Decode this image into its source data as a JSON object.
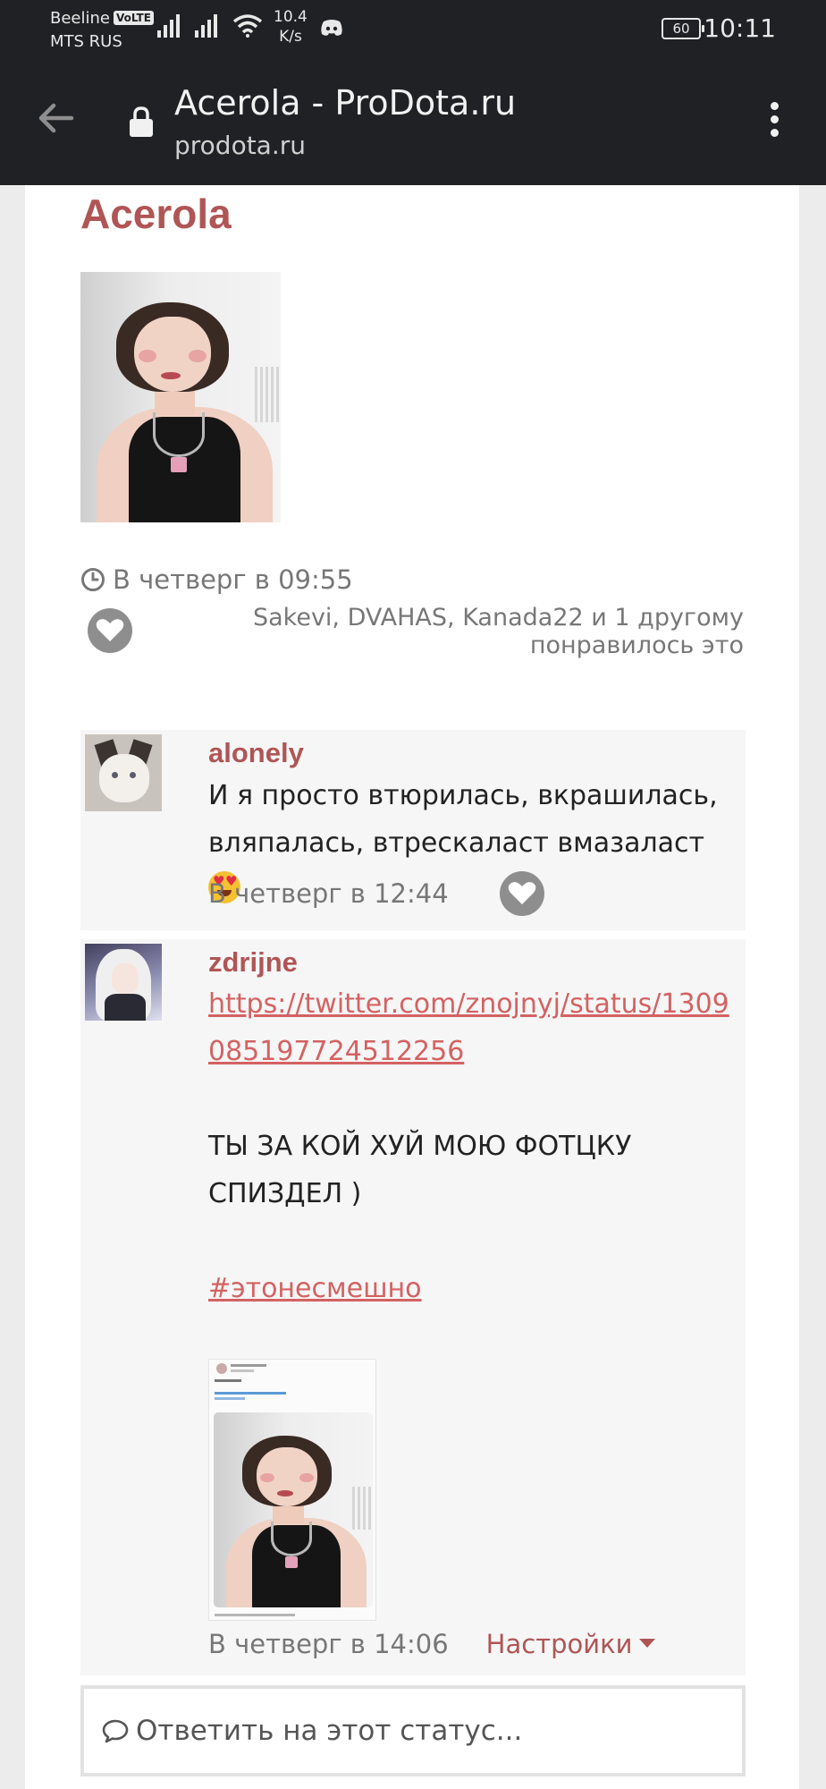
{
  "statusbar": {
    "carrier_1": "Beeline",
    "volte": "VoLTE",
    "carrier_2": "MTS RUS",
    "net_speed_value": "10.4",
    "net_speed_unit": "K/s",
    "battery": "60",
    "time": "10:11"
  },
  "browser": {
    "page_title": "Acerola - ProDota.ru",
    "url": "prodota.ru"
  },
  "profile": {
    "name": "Acerola",
    "post_time": "В четверг в 09:55",
    "likes_text": "Sakevi, DVAHAS, Kanada22 и 1 другому понравилось это"
  },
  "comments": [
    {
      "username": "alonely",
      "text": "И я просто втюрилась, вкрашилась, вляпалась, втрескаласт вмазаласт",
      "emoji": "smiling-face-with-heart-eyes",
      "time": "В четверг в 12:44"
    },
    {
      "username": "zdrijne",
      "link": "https://twitter.com/znojnyj/status/1309085197724512256",
      "line_1": "ТЫ ЗА КОЙ ХУЙ МОЮ ФОТЦКУ",
      "line_2": "СПИЗДЕЛ )",
      "hashtag": "#этонесмешно",
      "time": "В четверг в 14:06",
      "settings_label": "Настройки"
    }
  ],
  "reply": {
    "placeholder": "Ответить на этот статус..."
  },
  "colors": {
    "accent": "#b05555",
    "link": "#d46262",
    "toolbar_bg": "#202124"
  },
  "icons": [
    "signal-icon",
    "wifi-icon",
    "discord-icon",
    "battery-icon",
    "back-arrow-icon",
    "lock-icon",
    "more-vert-icon",
    "clock-icon",
    "heart-icon",
    "caret-down-icon",
    "comment-icon"
  ]
}
